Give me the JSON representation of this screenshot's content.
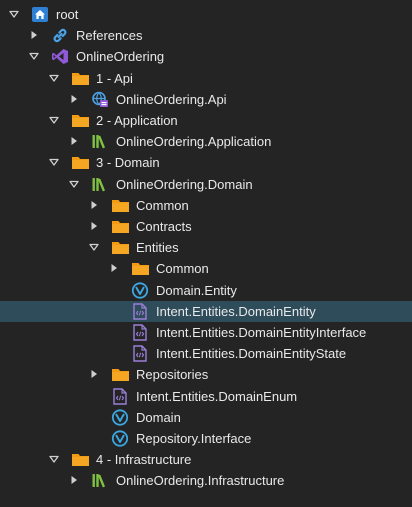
{
  "colors": {
    "background": "#242424",
    "selection": "#2e4c5a",
    "folder": "#f39c12",
    "text": "#e9e9e9"
  },
  "tree": [
    {
      "label": "root",
      "icon": "home-icon",
      "expander": "expanded",
      "level": 0
    },
    {
      "label": "References",
      "icon": "link-icon",
      "expander": "collapsed",
      "level": 1
    },
    {
      "label": "OnlineOrdering",
      "icon": "visual-studio-icon",
      "expander": "expanded",
      "level": 1
    },
    {
      "label": "1 - Api",
      "icon": "folder-icon",
      "expander": "expanded",
      "level": 2
    },
    {
      "label": "OnlineOrdering.Api",
      "icon": "api-globe-icon",
      "expander": "collapsed",
      "level": 3
    },
    {
      "label": "2 - Application",
      "icon": "folder-icon",
      "expander": "expanded",
      "level": 2
    },
    {
      "label": "OnlineOrdering.Application",
      "icon": "package-library-icon",
      "expander": "collapsed",
      "level": 3
    },
    {
      "label": "3 - Domain",
      "icon": "folder-icon",
      "expander": "expanded",
      "level": 2
    },
    {
      "label": "OnlineOrdering.Domain",
      "icon": "package-library-icon",
      "expander": "expanded",
      "level": 3
    },
    {
      "label": "Common",
      "icon": "folder-icon",
      "expander": "collapsed",
      "level": 4
    },
    {
      "label": "Contracts",
      "icon": "folder-icon",
      "expander": "collapsed",
      "level": 4
    },
    {
      "label": "Entities",
      "icon": "folder-icon",
      "expander": "expanded",
      "level": 4
    },
    {
      "label": "Common",
      "icon": "folder-icon",
      "expander": "collapsed",
      "level": 5
    },
    {
      "label": "Domain.Entity",
      "icon": "module-icon",
      "expander": "none",
      "level": 5
    },
    {
      "label": "Intent.Entities.DomainEntity",
      "icon": "template-file-icon",
      "expander": "none",
      "level": 5,
      "selected": true
    },
    {
      "label": "Intent.Entities.DomainEntityInterface",
      "icon": "template-file-icon",
      "expander": "none",
      "level": 5
    },
    {
      "label": "Intent.Entities.DomainEntityState",
      "icon": "template-file-icon",
      "expander": "none",
      "level": 5
    },
    {
      "label": "Repositories",
      "icon": "folder-icon",
      "expander": "collapsed",
      "level": 4
    },
    {
      "label": "Intent.Entities.DomainEnum",
      "icon": "template-file-icon",
      "expander": "none",
      "level": 4
    },
    {
      "label": "Domain",
      "icon": "module-icon",
      "expander": "none",
      "level": 4
    },
    {
      "label": "Repository.Interface",
      "icon": "module-icon",
      "expander": "none",
      "level": 4
    },
    {
      "label": "4 - Infrastructure",
      "icon": "folder-icon",
      "expander": "expanded",
      "level": 2
    },
    {
      "label": "OnlineOrdering.Infrastructure",
      "icon": "package-library-icon",
      "expander": "collapsed",
      "level": 3
    }
  ]
}
